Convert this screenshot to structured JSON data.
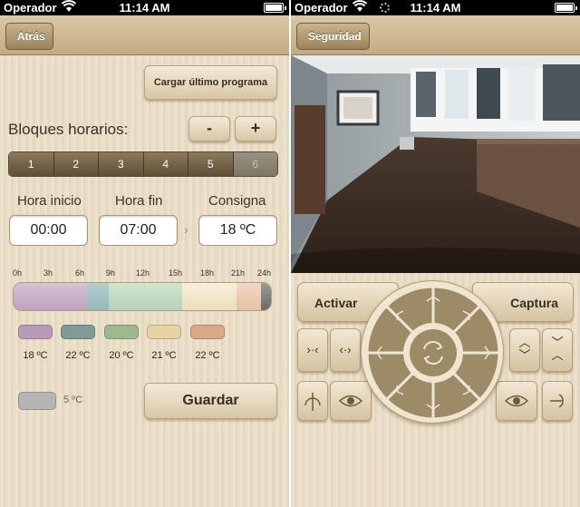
{
  "status_left": {
    "carrier": "Operador",
    "time": "11:14 AM"
  },
  "status_right": {
    "carrier": "Operador",
    "time": "11:14 AM"
  },
  "left": {
    "back_label": "Atrás",
    "load_button": "Cargar último programa",
    "blocks_label": "Bloques horarios:",
    "minus": "-",
    "plus": "+",
    "blocks": [
      "1",
      "2",
      "3",
      "4",
      "5",
      "6"
    ],
    "start_label": "Hora inicio",
    "end_label": "Hora fin",
    "setpoint_label": "Consigna",
    "start_value": "00:00",
    "end_value": "07:00",
    "setpoint_value": "18 ºC",
    "ticks": [
      "0h",
      "3h",
      "6h",
      "9h",
      "12h",
      "15h",
      "18h",
      "21h",
      "24h"
    ],
    "swatches": [
      {
        "color": "#b89bb8",
        "temp": "18 ºC"
      },
      {
        "color": "#7f9b95",
        "temp": "22 ºC"
      },
      {
        "color": "#9fb892",
        "temp": "20 ºC"
      },
      {
        "color": "#e6d2a4",
        "temp": "21 ºC"
      },
      {
        "color": "#d9a98a",
        "temp": "22 ºC"
      }
    ],
    "off_swatch": {
      "color": "#b4b4b4",
      "temp": "5 ºC"
    },
    "save_button": "Guardar"
  },
  "right": {
    "back_label": "Seguridad",
    "activate_label": "Activar",
    "capture_label": "Captura"
  },
  "colors": {
    "accent": "#8a7658",
    "wheel": "#9d8a67",
    "bg": "#e8dcc6"
  }
}
